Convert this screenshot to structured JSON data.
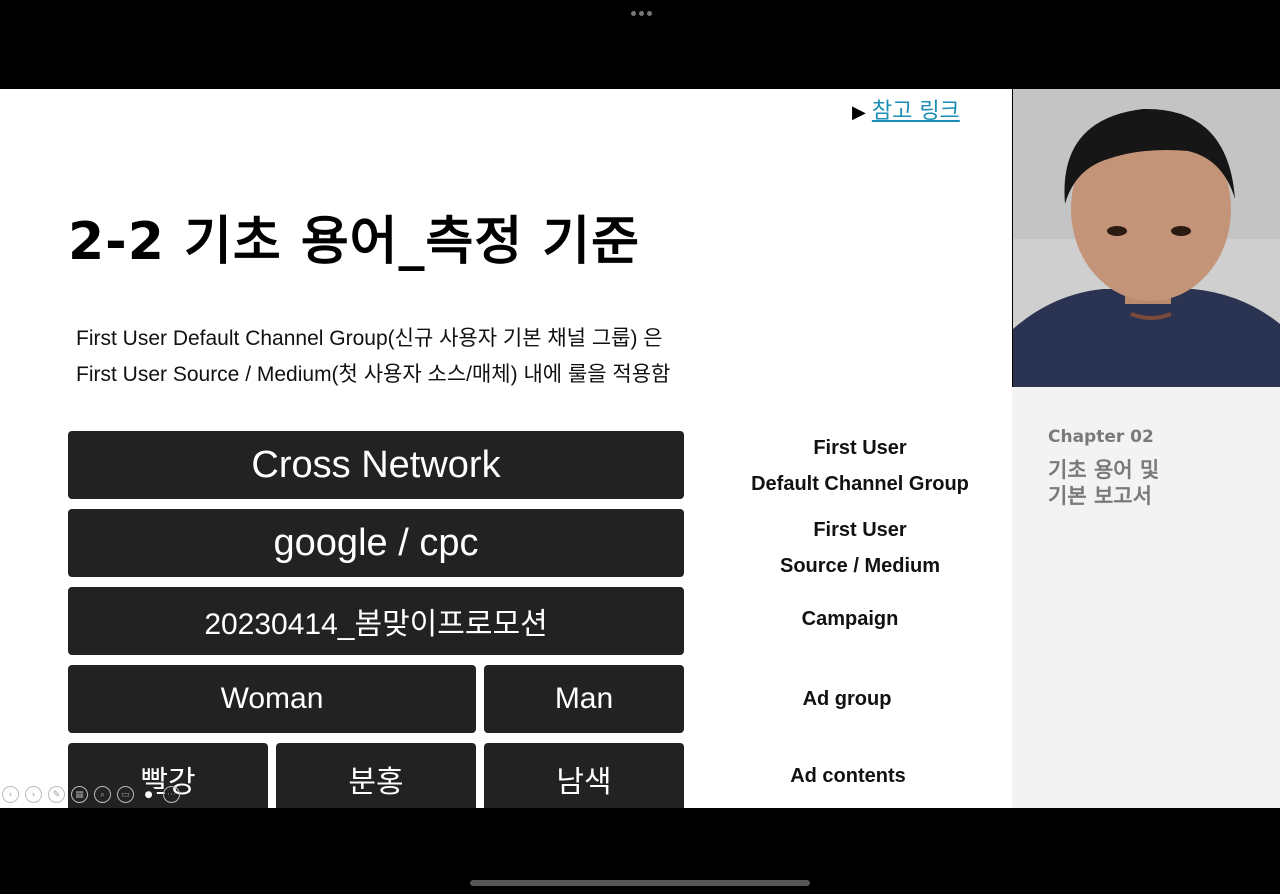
{
  "slide": {
    "ref_link_arrow": "▶",
    "ref_link_label": "참고 링크",
    "title": "2-2 기초 용어_측정 기준",
    "description": {
      "line1": "First User Default Channel Group(신규 사용자 기본 채널 그룹) 은",
      "line2": "First User Source / Medium(첫 사용자 소스/매체) 내에 룰을 적용함"
    },
    "boxes": {
      "channel_group": "Cross Network",
      "source_medium": "google / cpc",
      "campaign": "20230414_봄맞이프로모션",
      "ad_group_woman": "Woman",
      "ad_group_man": "Man",
      "ad_content_red": "빨강",
      "ad_content_pink": "분홍",
      "ad_content_navy": "남색"
    },
    "labels": {
      "channel_group_line1": "First User",
      "channel_group_line2": "Default Channel Group",
      "source_medium_line1": "First User",
      "source_medium_line2": "Source / Medium",
      "campaign": "Campaign",
      "ad_group": "Ad group",
      "ad_contents": "Ad contents"
    }
  },
  "side_panel": {
    "chapter_number": "Chapter 02",
    "chapter_title_line1": "기초 용어 및",
    "chapter_title_line2": "기본 보고서"
  },
  "toolbar_icons": [
    "previous-icon",
    "next-icon",
    "pen-icon",
    "slides-grid-icon",
    "zoom-icon",
    "subtitles-icon",
    "camera-icon",
    "more-icon"
  ],
  "colors": {
    "box_bg": "#222222",
    "link": "#1b8fb3",
    "chapter_text": "#7a7a7a",
    "side_panel_bg": "#f3f3f3"
  }
}
